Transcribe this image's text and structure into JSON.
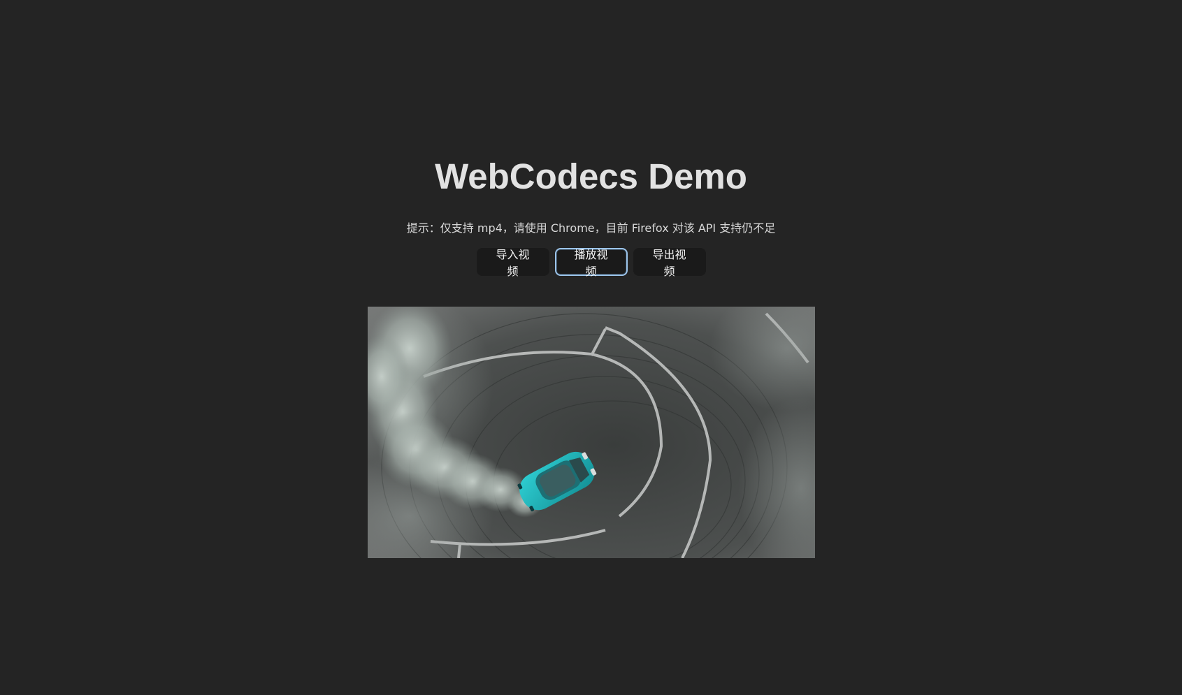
{
  "page": {
    "title": "WebCodecs Demo",
    "hint": "提示：仅支持 mp4，请使用 Chrome，目前 Firefox 对该 API 支持仍不足"
  },
  "toolbar": {
    "import_label": "导入视频",
    "play_label": "播放视频",
    "export_label": "导出视频"
  },
  "colors": {
    "background": "#242424",
    "button_bg": "#1a1a1a",
    "focus_ring": "#9cc4ea",
    "car": "#1fb3b8"
  }
}
